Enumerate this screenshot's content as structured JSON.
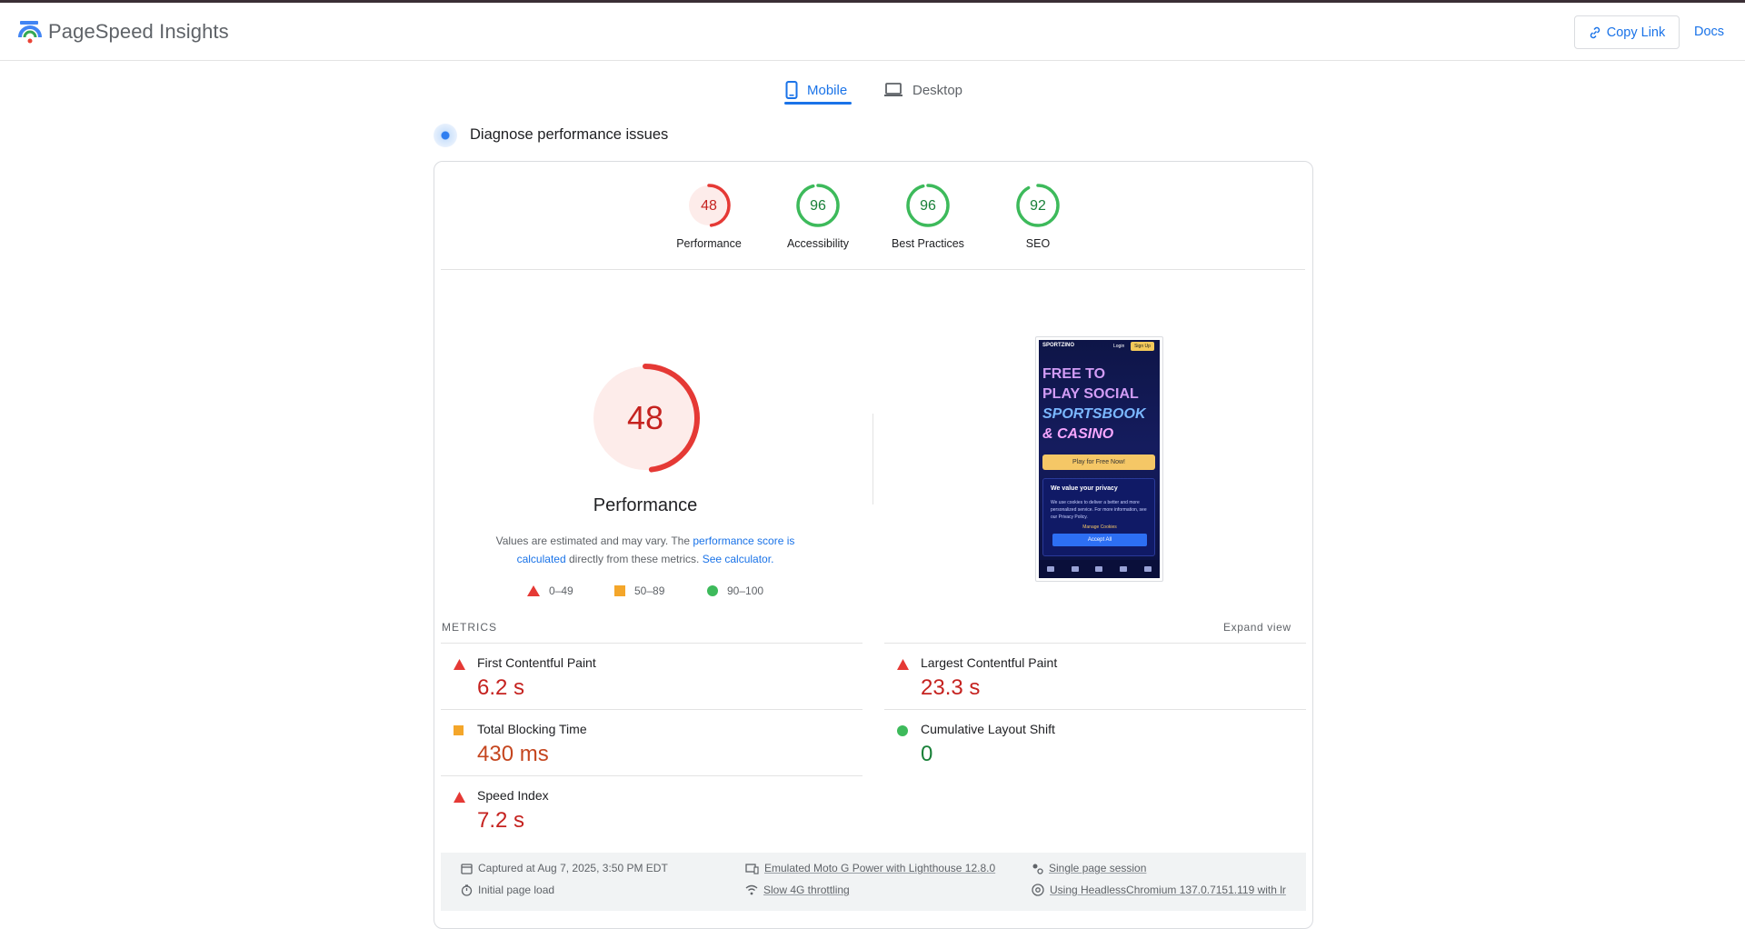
{
  "header": {
    "brand": "PageSpeed Insights",
    "copy_link_label": "Copy Link",
    "docs_label": "Docs"
  },
  "tabs": [
    {
      "label": "Mobile",
      "active": true,
      "icon": "phone-icon"
    },
    {
      "label": "Desktop",
      "active": false,
      "icon": "laptop-icon"
    }
  ],
  "section_title": "Diagnose performance issues",
  "scores": [
    {
      "label": "Performance",
      "value": 48,
      "status": "fail"
    },
    {
      "label": "Accessibility",
      "value": 96,
      "status": "pass"
    },
    {
      "label": "Best Practices",
      "value": 96,
      "status": "pass"
    },
    {
      "label": "SEO",
      "value": 92,
      "status": "pass"
    }
  ],
  "performance": {
    "score": 48,
    "title": "Performance",
    "note_prefix": "Values are estimated and may vary. The ",
    "note_link1": "performance score is calculated",
    "note_middle": " directly from these metrics. ",
    "note_link2": "See calculator."
  },
  "legend": [
    {
      "label": "0–49",
      "shape": "triangle",
      "color": "#e53935"
    },
    {
      "label": "50–89",
      "shape": "square",
      "color": "#f4a62a"
    },
    {
      "label": "90–100",
      "shape": "circle",
      "color": "#3dba5b"
    }
  ],
  "screenshot": {
    "brand": "SPORTZINO",
    "login": "Login",
    "signup": "Sign Up",
    "hero_line1": "FREE TO",
    "hero_line2": "PLAY SOCIAL",
    "hero_line3": "SPORTSBOOK",
    "hero_line4": "& CASINO",
    "play_button": "Play for Free Now!",
    "privacy_title": "We value your privacy",
    "privacy_body": "We use cookies to deliver a better and more personalized service. For more information, see our Privacy Policy.",
    "manage": "Manage Cookies",
    "accept": "Accept All"
  },
  "metrics": {
    "heading": "METRICS",
    "expand_label": "Expand view",
    "items": [
      {
        "name": "First Contentful Paint",
        "value": "6.2 s",
        "status": "fail"
      },
      {
        "name": "Largest Contentful Paint",
        "value": "23.3 s",
        "status": "fail"
      },
      {
        "name": "Total Blocking Time",
        "value": "430 ms",
        "status": "average"
      },
      {
        "name": "Cumulative Layout Shift",
        "value": "0",
        "status": "pass"
      },
      {
        "name": "Speed Index",
        "value": "7.2 s",
        "status": "fail"
      }
    ]
  },
  "footer": {
    "captured": "Captured at Aug 7, 2025, 3:50 PM EDT",
    "initial_load": "Initial page load",
    "device": "Emulated Moto G Power with Lighthouse 12.8.0",
    "throttling": "Slow 4G throttling",
    "session": "Single page session",
    "browser": "Using HeadlessChromium 137.0.7151.119 with lr"
  },
  "colors": {
    "accent": "#1a73e8",
    "fail": "#e53935",
    "fail_text": "#c5221f",
    "average": "#f4a62a",
    "average_text": "#c5461f",
    "pass": "#3dba5b",
    "pass_text": "#188038"
  }
}
